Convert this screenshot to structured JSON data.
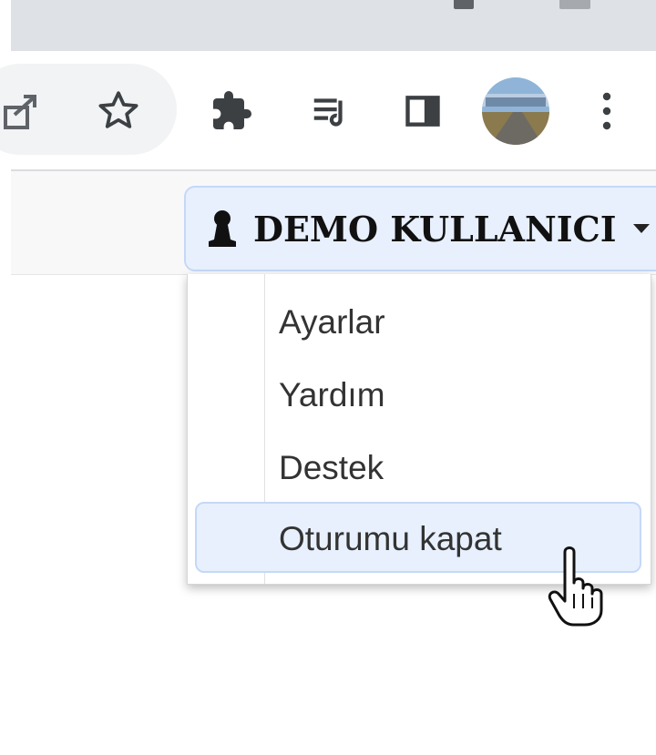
{
  "browser": {
    "toolbar_icons": [
      "share-icon",
      "bookmark-star-icon",
      "extensions-puzzle-icon",
      "media-queue-icon",
      "side-panel-icon",
      "profile-avatar-icon",
      "more-menu-icon"
    ]
  },
  "user_menu": {
    "username": "DEMO KULLANICI",
    "items": [
      {
        "label": "Ayarlar"
      },
      {
        "label": "Yardım"
      },
      {
        "label": "Destek"
      },
      {
        "label": "Oturumu kapat"
      }
    ],
    "hovered_index": 3
  },
  "colors": {
    "accent_bg": "#e8f0fe",
    "accent_border": "#c5d8f8"
  }
}
